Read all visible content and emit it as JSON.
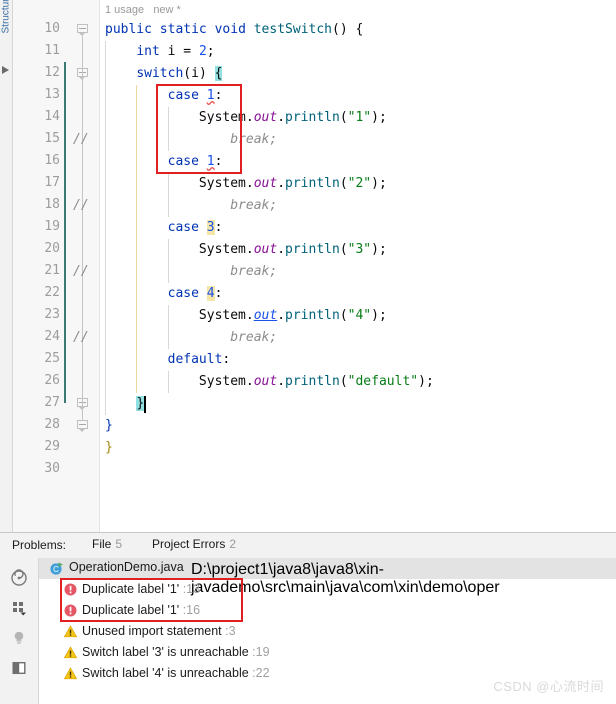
{
  "editor": {
    "vertical_tab_label": "Structure",
    "code_vision_hint": "1 usage   new *",
    "line_numbers": [
      "10",
      "11",
      "12",
      "13",
      "14",
      "15",
      "16",
      "17",
      "18",
      "19",
      "20",
      "21",
      "22",
      "23",
      "24",
      "25",
      "26",
      "27",
      "28",
      "29",
      "30"
    ],
    "lines": [
      {
        "n": "10",
        "indent_comment": "",
        "text": "public static void testSwitch() {"
      },
      {
        "n": "11",
        "indent_comment": "",
        "text": "    int i = 2;"
      },
      {
        "n": "12",
        "indent_comment": "",
        "text": "    switch(i) {"
      },
      {
        "n": "13",
        "indent_comment": "",
        "text": "        case 1:"
      },
      {
        "n": "14",
        "indent_comment": "",
        "text": "            System.out.println(\"1\");"
      },
      {
        "n": "15",
        "indent_comment": "//",
        "text": "                break;"
      },
      {
        "n": "16",
        "indent_comment": "",
        "text": "        case 1:"
      },
      {
        "n": "17",
        "indent_comment": "",
        "text": "            System.out.println(\"2\");"
      },
      {
        "n": "18",
        "indent_comment": "//",
        "text": "                break;"
      },
      {
        "n": "19",
        "indent_comment": "",
        "text": "        case 3:"
      },
      {
        "n": "20",
        "indent_comment": "",
        "text": "            System.out.println(\"3\");"
      },
      {
        "n": "21",
        "indent_comment": "//",
        "text": "                break;"
      },
      {
        "n": "22",
        "indent_comment": "",
        "text": "        case 4:"
      },
      {
        "n": "23",
        "indent_comment": "",
        "text": "            System.out.println(\"4\");"
      },
      {
        "n": "24",
        "indent_comment": "//",
        "text": "                break;"
      },
      {
        "n": "25",
        "indent_comment": "",
        "text": "        default:"
      },
      {
        "n": "26",
        "indent_comment": "",
        "text": "            System.out.println(\"default\");"
      },
      {
        "n": "27",
        "indent_comment": "",
        "text": "    }"
      },
      {
        "n": "28",
        "indent_comment": "",
        "text": "}"
      },
      {
        "n": "29",
        "indent_comment": "",
        "text": "}"
      },
      {
        "n": "30",
        "indent_comment": "",
        "text": ""
      }
    ],
    "tokens": {
      "kw_public": "public",
      "kw_static": "static",
      "kw_void": "void",
      "method_name": "testSwitch",
      "kw_int": "int",
      "var_i": "i",
      "kw_switch": "switch",
      "kw_case": "case",
      "kw_default": "default",
      "kw_break": "break;",
      "comment_slashes": "//",
      "obj_system": "System",
      "field_out": "out",
      "method_println": "println",
      "str_1": "\"1\"",
      "str_2": "\"2\"",
      "str_3": "\"3\"",
      "str_4": "\"4\"",
      "str_default": "\"default\"",
      "num_2": "2",
      "num_1": "1",
      "num_3": "3",
      "num_4": "4",
      "brace_open": "{",
      "brace_close": "}"
    },
    "current_line": "27",
    "colors": {
      "keyword": "#0033b3",
      "number": "#1750eb",
      "string": "#067d17",
      "comment": "#8c8c8c",
      "field": "#871094",
      "method": "#00627a",
      "brace_highlight": "#93e0e3",
      "number_highlight": "#f5e6a8",
      "current_line_bg": "#fcfae4",
      "error_underline": "#e84a4a",
      "annotation_box": "#e02020",
      "vcs_marker": "#3a7a72"
    }
  },
  "problems": {
    "label": "Problems:",
    "tabs": [
      {
        "name": "File",
        "label": "File",
        "count": "5",
        "selected": true
      },
      {
        "name": "Project Errors",
        "label": "Project Errors",
        "count": "2",
        "selected": false
      }
    ],
    "sidebar_icons": [
      {
        "name": "inspection-scope-icon",
        "glyph": "scope"
      },
      {
        "name": "group-by-icon",
        "glyph": "group"
      },
      {
        "name": "lightbulb-icon",
        "glyph": "bulb"
      },
      {
        "name": "preview-pane-icon",
        "glyph": "preview"
      }
    ],
    "file_row": {
      "icon": "java-class-run-icon",
      "filename": "OperationDemo.java",
      "path": "D:\\project1\\java8\\java8\\xin-javademo\\src\\main\\java\\com\\xin\\demo\\oper"
    },
    "items": [
      {
        "severity": "error",
        "message": "Duplicate label '1'",
        "line": ":13",
        "boxed": true
      },
      {
        "severity": "error",
        "message": "Duplicate label '1'",
        "line": ":16",
        "boxed": true
      },
      {
        "severity": "warning",
        "message": "Unused import statement",
        "line": ":3",
        "boxed": false
      },
      {
        "severity": "warning",
        "message": "Switch label '3' is unreachable",
        "line": ":19",
        "boxed": false
      },
      {
        "severity": "warning",
        "message": "Switch label '4' is unreachable",
        "line": ":22",
        "boxed": false
      }
    ]
  },
  "watermark": {
    "text": "CSDN @心流时间"
  }
}
